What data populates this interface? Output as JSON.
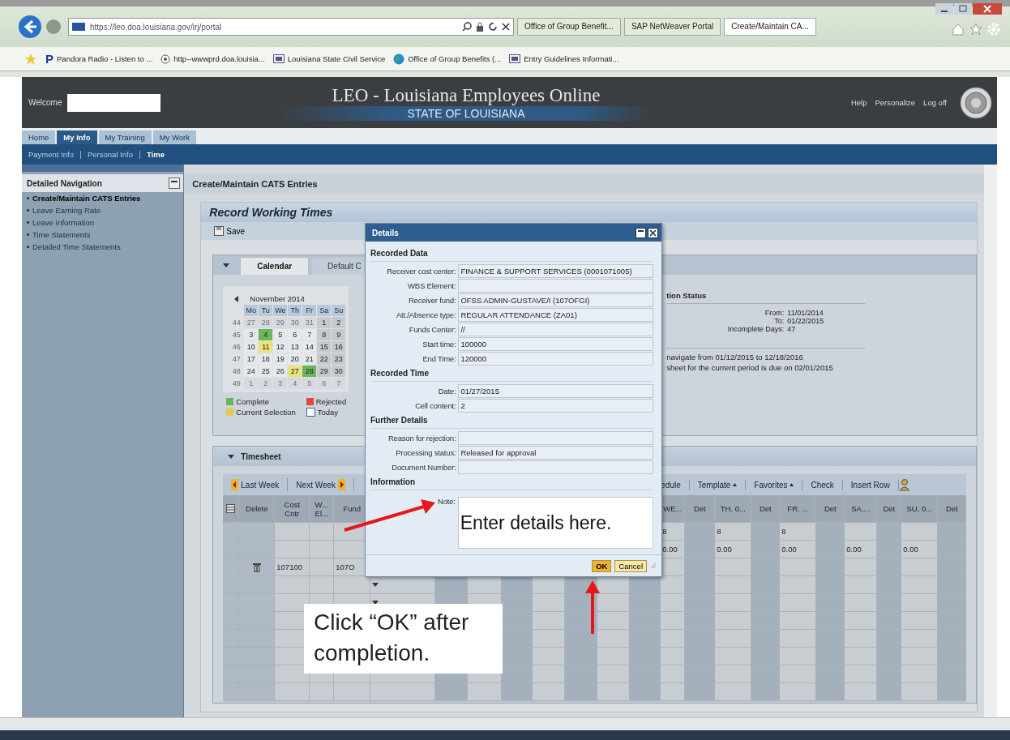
{
  "browser": {
    "address": "https://leo.doa.louisiana.gov/irj/portal",
    "tabs": [
      {
        "label": "Office of Group Benefit...",
        "selected": false
      },
      {
        "label": "SAP NetWeaver Portal",
        "selected": false
      },
      {
        "label": "Create/Maintain CA...",
        "selected": true
      }
    ],
    "favorites": [
      {
        "label": "Pandora Radio - Listen to ...",
        "kind": "letter",
        "badge": "P"
      },
      {
        "label": "http--wwwprd.doa.louisia...",
        "kind": "circle"
      },
      {
        "label": "Louisiana State Civil Service",
        "kind": "site"
      },
      {
        "label": "Office of Group Benefits (...",
        "kind": "globe"
      },
      {
        "label": "Entry Guidelines Informati...",
        "kind": "site"
      }
    ]
  },
  "portal": {
    "welcome": "Welcome",
    "title": "LEO - Louisiana Employees Online",
    "subtitle": "STATE OF LOUISIANA",
    "links": [
      "Help",
      "Personalize",
      "Log off"
    ],
    "tabs": [
      {
        "label": "Home",
        "selected": false
      },
      {
        "label": "My Info",
        "selected": true
      },
      {
        "label": "My Training",
        "selected": false
      },
      {
        "label": "My Work",
        "selected": false
      }
    ],
    "subtabs": [
      {
        "label": "Payment Info",
        "selected": false
      },
      {
        "label": "Personal Info",
        "selected": false
      },
      {
        "label": "Time",
        "selected": true
      }
    ]
  },
  "sidebar": {
    "title": "Detailed Navigation",
    "items": [
      {
        "label": "Create/Maintain CATS Entries",
        "selected": true
      },
      {
        "label": "Leave Earning Rate",
        "selected": false
      },
      {
        "label": "Leave Information",
        "selected": false
      },
      {
        "label": "Time Statements",
        "selected": false
      },
      {
        "label": "Detailed Time Statements",
        "selected": false
      }
    ]
  },
  "content": {
    "page_title": "Create/Maintain CATS Entries",
    "section_title": "Record Working Times",
    "save": "Save"
  },
  "calendar_panel": {
    "tabs": [
      {
        "label": "Calendar",
        "selected": true
      },
      {
        "label": "Default C",
        "selected": false
      }
    ],
    "month": "November 2014",
    "weekdays": [
      "Mo",
      "Tu",
      "We",
      "Th",
      "Fr",
      "Sa",
      "Su"
    ],
    "weeks": [
      {
        "number": "44",
        "days": [
          {
            "day": "27",
            "kind": "other"
          },
          {
            "day": "28",
            "kind": "other"
          },
          {
            "day": "29",
            "kind": "other"
          },
          {
            "day": "30",
            "kind": "other"
          },
          {
            "day": "31",
            "kind": "other"
          },
          {
            "day": "1",
            "kind": "day"
          },
          {
            "day": "2",
            "kind": "day"
          }
        ]
      },
      {
        "number": "45",
        "days": [
          {
            "day": "3",
            "kind": "day"
          },
          {
            "day": "4",
            "kind": "complete"
          },
          {
            "day": "5",
            "kind": "day"
          },
          {
            "day": "6",
            "kind": "day"
          },
          {
            "day": "7",
            "kind": "day"
          },
          {
            "day": "8",
            "kind": "day"
          },
          {
            "day": "9",
            "kind": "day"
          }
        ]
      },
      {
        "number": "46",
        "days": [
          {
            "day": "10",
            "kind": "day"
          },
          {
            "day": "11",
            "kind": "selection"
          },
          {
            "day": "12",
            "kind": "day"
          },
          {
            "day": "13",
            "kind": "day"
          },
          {
            "day": "14",
            "kind": "day"
          },
          {
            "day": "15",
            "kind": "day"
          },
          {
            "day": "16",
            "kind": "day"
          }
        ]
      },
      {
        "number": "47",
        "days": [
          {
            "day": "17",
            "kind": "day"
          },
          {
            "day": "18",
            "kind": "day"
          },
          {
            "day": "19",
            "kind": "day"
          },
          {
            "day": "20",
            "kind": "day"
          },
          {
            "day": "21",
            "kind": "day"
          },
          {
            "day": "22",
            "kind": "day"
          },
          {
            "day": "23",
            "kind": "day"
          }
        ]
      },
      {
        "number": "48",
        "days": [
          {
            "day": "24",
            "kind": "day"
          },
          {
            "day": "25",
            "kind": "day"
          },
          {
            "day": "26",
            "kind": "day"
          },
          {
            "day": "27",
            "kind": "selection"
          },
          {
            "day": "28",
            "kind": "complete"
          },
          {
            "day": "29",
            "kind": "day"
          },
          {
            "day": "30",
            "kind": "day"
          }
        ]
      },
      {
        "number": "49",
        "days": [
          {
            "day": "1",
            "kind": "other"
          },
          {
            "day": "2",
            "kind": "other"
          },
          {
            "day": "3",
            "kind": "other"
          },
          {
            "day": "4",
            "kind": "other"
          },
          {
            "day": "5",
            "kind": "other"
          },
          {
            "day": "6",
            "kind": "other"
          },
          {
            "day": "7",
            "kind": "other"
          }
        ]
      }
    ],
    "legend": [
      {
        "label": "Complete",
        "kind": "fill",
        "color": "#6cb55a"
      },
      {
        "label": "Rejected",
        "kind": "fill",
        "color": "#e04a3a"
      },
      {
        "label": "Current Selection",
        "kind": "fill",
        "color": "#e8c850"
      },
      {
        "label": "Today",
        "kind": "outline",
        "color": "#3a6a9a"
      }
    ]
  },
  "status": {
    "title": "tion Status",
    "fields": [
      {
        "label": "From:",
        "value": "11/01/2014"
      },
      {
        "label": "To:",
        "value": "01/22/2015"
      },
      {
        "label": "Incomplete Days:",
        "value": "47"
      }
    ],
    "messages": [
      "navigate from 01/12/2015 to 12/18/2016",
      "sheet for the current period is due on 02/01/2015"
    ]
  },
  "timesheet": {
    "title": "Timesheet",
    "toolbar": [
      {
        "label": "Last Week",
        "kind": "prev"
      },
      {
        "label": "Next Week",
        "kind": "next"
      },
      {
        "label": "edule",
        "kind": "plain"
      },
      {
        "label": "Template",
        "kind": "menu"
      },
      {
        "label": "Favorites",
        "kind": "menu"
      },
      {
        "label": "Check",
        "kind": "plain"
      },
      {
        "label": "Insert Row",
        "kind": "plain"
      }
    ],
    "columns": [
      null,
      "Delete",
      "Cost Cntr",
      "W... El...",
      "Fund",
      null,
      null,
      null,
      null,
      null,
      null,
      null,
      null,
      "WE...",
      "Det",
      "TH. 0...",
      "Det",
      "FR. ...",
      "Det",
      "SA,...",
      "Det",
      "SU, 0...",
      "Det"
    ],
    "rows": [
      {
        "deletable": false,
        "cells": [
          null,
          null,
          null,
          null,
          null,
          null,
          null,
          null,
          null,
          null,
          null,
          null,
          null,
          "8",
          null,
          "8",
          null,
          "8",
          null,
          null,
          null,
          null,
          null
        ]
      },
      {
        "deletable": false,
        "cells": [
          null,
          null,
          null,
          null,
          null,
          null,
          null,
          null,
          null,
          null,
          null,
          null,
          null,
          "0.00",
          null,
          "0.00",
          null,
          "0.00",
          null,
          "0.00",
          null,
          "0.00",
          null
        ]
      },
      {
        "deletable": true,
        "cells": [
          null,
          null,
          "107100",
          null,
          "107O",
          null,
          null,
          null,
          null,
          null,
          null,
          null,
          null,
          null,
          null,
          null,
          null,
          null,
          null,
          null,
          null,
          null,
          null
        ]
      },
      {
        "deletable": false,
        "dropdown": true,
        "cells": [
          null,
          null,
          null,
          null,
          null,
          null,
          null,
          null,
          null,
          null,
          null,
          null,
          null,
          null,
          null,
          null,
          null,
          null,
          null,
          null,
          null,
          null,
          null
        ]
      },
      {
        "deletable": false,
        "dropdown": true,
        "cells": [
          null,
          null,
          null,
          null,
          null,
          null,
          null,
          null,
          null,
          null,
          null,
          null,
          null,
          null,
          null,
          null,
          null,
          null,
          null,
          null,
          null,
          null,
          null
        ]
      }
    ]
  },
  "dialog": {
    "title": "Details",
    "sections": [
      {
        "title": "Recorded Data",
        "fields": [
          {
            "label": "Receiver cost center:",
            "value": "FINANCE & SUPPORT SERVICES (0001071005)"
          },
          {
            "label": "WBS Element:"
          },
          {
            "label": "Receiver fund:",
            "value": "OFSS ADMIN-GUSTAVE/I (107OFGI)"
          },
          {
            "label": "Att./Absence type:",
            "value": "REGULAR ATTENDANCE (ZA01)"
          },
          {
            "label": "Funds Center:",
            "value": "//"
          },
          {
            "label": "Start time:",
            "value": "100000"
          },
          {
            "label": "End Time:",
            "value": "120000"
          }
        ]
      },
      {
        "title": "Recorded Time",
        "fields": [
          {
            "label": "Date:",
            "value": "01/27/2015"
          },
          {
            "label": "Cell content:",
            "value": "2"
          }
        ]
      },
      {
        "title": "Further Details",
        "fields": [
          {
            "label": "Reason for rejection:"
          },
          {
            "label": "Processing status:",
            "value": "Released for approval"
          },
          {
            "label": "Document Number:"
          }
        ]
      },
      {
        "title": "Information"
      }
    ],
    "note": {
      "label": "Note:",
      "value": "Enter details here."
    },
    "buttons": [
      {
        "label": "OK",
        "primary": true
      },
      {
        "label": "Cancel",
        "primary": false
      }
    ]
  },
  "annotation": {
    "callout": "Click “OK” after completion."
  }
}
